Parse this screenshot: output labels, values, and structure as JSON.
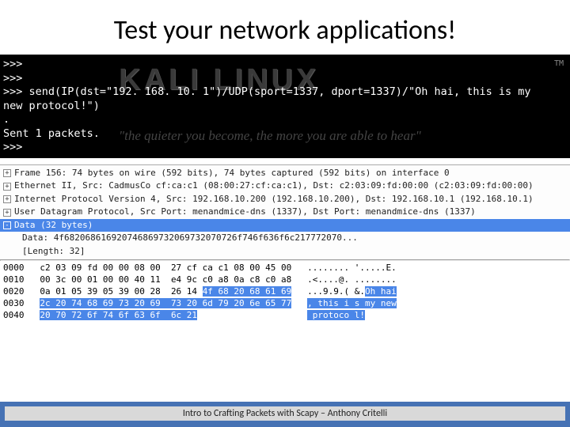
{
  "title": "Test your network applications!",
  "terminal": {
    "brand": "KALI LINUX",
    "tm": "TM",
    "slogan": "\"the quieter you become, the more you are able to hear\"",
    "lines": [
      ">>>",
      ">>>",
      ">>> send(IP(dst=\"192. 168. 10. 1\")/UDP(sport=1337, dport=1337)/\"Oh hai, this is my",
      "new protocol!\")",
      ".",
      "Sent 1 packets.",
      ">>>"
    ]
  },
  "wireshark": {
    "tree": [
      {
        "icon": "+",
        "sel": false,
        "text": "Frame 156: 74 bytes on wire (592 bits), 74 bytes captured (592 bits) on interface 0"
      },
      {
        "icon": "+",
        "sel": false,
        "text": "Ethernet II, Src: CadmusCo cf:ca:c1 (08:00:27:cf:ca:c1), Dst: c2:03:09:fd:00:00 (c2:03:09:fd:00:00)"
      },
      {
        "icon": "+",
        "sel": false,
        "text": "Internet Protocol Version 4, Src: 192.168.10.200 (192.168.10.200), Dst: 192.168.10.1 (192.168.10.1)"
      },
      {
        "icon": "+",
        "sel": false,
        "text": "User Datagram Protocol, Src Port: menandmice-dns (1337), Dst Port: menandmice-dns (1337)"
      },
      {
        "icon": "-",
        "sel": true,
        "text": "Data (32 bytes)"
      }
    ],
    "children": [
      "Data: 4f682068616920746869732069732070726f746f636f6c217772070...",
      "[Length: 32]"
    ],
    "hex": [
      {
        "off": "0000",
        "bytes": "c2 03 09 fd 00 00 08 00  27 cf ca c1 08 00 45 00",
        "ascii": "........ '.....E."
      },
      {
        "off": "0010",
        "bytes": "00 3c 00 01 00 00 40 11  e4 9c c0 a8 0a c8 c0 a8",
        "ascii": ".<....@. ........"
      },
      {
        "off": "0020",
        "bytes": "0a 01 05 39 05 39 00 28  26 14 ",
        "hl_bytes": "4f 68 20 68 61 69",
        "ascii": "...9.9.( &.",
        "hl_ascii": "Oh hai"
      },
      {
        "off": "0030",
        "bytes": "",
        "hl_bytes": "2c 20 74 68 69 73 20 69  73 20 6d 79 20 6e 65 77",
        "ascii": "",
        "hl_ascii": ", this i s my new"
      },
      {
        "off": "0040",
        "bytes": "",
        "hl_bytes": "20 70 72 6f 74 6f 63 6f  6c 21",
        "ascii": "",
        "hl_ascii": " protoco l!"
      }
    ]
  },
  "footer": "Intro to Crafting Packets with Scapy – Anthony Critelli"
}
